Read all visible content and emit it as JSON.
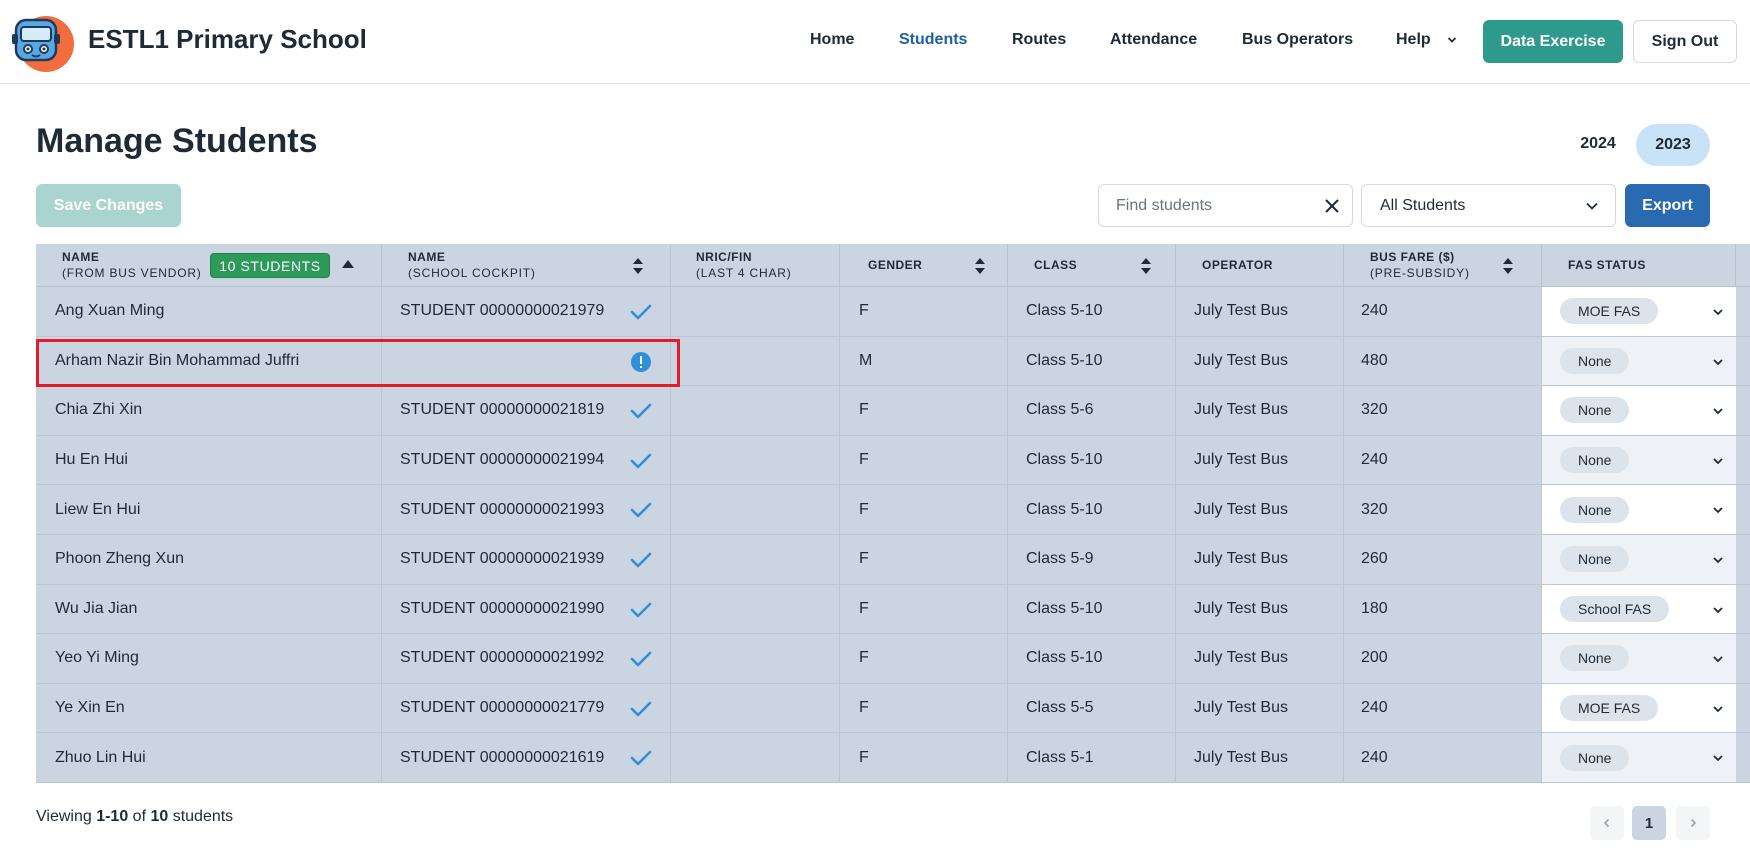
{
  "header": {
    "school_name": "ESTL1 Primary School",
    "nav": [
      {
        "label": "Home",
        "active": false
      },
      {
        "label": "Students",
        "active": true
      },
      {
        "label": "Routes",
        "active": false
      },
      {
        "label": "Attendance",
        "active": false
      },
      {
        "label": "Bus Operators",
        "active": false
      },
      {
        "label": "Help",
        "active": false,
        "has_dropdown": true
      }
    ],
    "data_exercise_label": "Data Exercise",
    "sign_out_label": "Sign Out"
  },
  "page": {
    "title": "Manage Students",
    "years": [
      "2024",
      "2023"
    ],
    "selected_year": "2023",
    "save_label": "Save Changes",
    "search": {
      "placeholder": "Find students",
      "value": ""
    },
    "filter": {
      "selected": "All Students"
    },
    "export_label": "Export"
  },
  "table": {
    "columns": {
      "name_vendor": {
        "l1": "NAME",
        "l2": "(FROM BUS VENDOR)"
      },
      "student_count": "10 STUDENTS",
      "name_cockpit": {
        "l1": "NAME",
        "l2": "(SCHOOL COCKPIT)"
      },
      "nric": {
        "l1": "NRIC/FIN",
        "l2": "(LAST 4 CHAR)"
      },
      "gender": "GENDER",
      "class": "CLASS",
      "operator": "OPERATOR",
      "fare": {
        "l1": "BUS FARE ($)",
        "l2": "(PRE-SUBSIDY)"
      },
      "fas": "FAS STATUS"
    },
    "rows": [
      {
        "vendor_name": "Ang Xuan Ming",
        "cockpit_name": "STUDENT 00000000021979",
        "matched": true,
        "nric": "",
        "gender": "F",
        "class": "Class 5-10",
        "operator": "July Test Bus",
        "fare": "240",
        "fas": "MOE FAS"
      },
      {
        "vendor_name": "Arham Nazir Bin Mohammad Juffri",
        "cockpit_name": "",
        "matched": false,
        "nric": "",
        "gender": "M",
        "class": "Class 5-10",
        "operator": "July Test Bus",
        "fare": "480",
        "fas": "None"
      },
      {
        "vendor_name": "Chia Zhi Xin",
        "cockpit_name": "STUDENT 00000000021819",
        "matched": true,
        "nric": "",
        "gender": "F",
        "class": "Class 5-6",
        "operator": "July Test Bus",
        "fare": "320",
        "fas": "None"
      },
      {
        "vendor_name": "Hu En Hui",
        "cockpit_name": "STUDENT 00000000021994",
        "matched": true,
        "nric": "",
        "gender": "F",
        "class": "Class 5-10",
        "operator": "July Test Bus",
        "fare": "240",
        "fas": "None"
      },
      {
        "vendor_name": "Liew En Hui",
        "cockpit_name": "STUDENT 00000000021993",
        "matched": true,
        "nric": "",
        "gender": "F",
        "class": "Class 5-10",
        "operator": "July Test Bus",
        "fare": "320",
        "fas": "None"
      },
      {
        "vendor_name": "Phoon Zheng Xun",
        "cockpit_name": "STUDENT 00000000021939",
        "matched": true,
        "nric": "",
        "gender": "F",
        "class": "Class 5-9",
        "operator": "July Test Bus",
        "fare": "260",
        "fas": "None"
      },
      {
        "vendor_name": "Wu Jia Jian",
        "cockpit_name": "STUDENT 00000000021990",
        "matched": true,
        "nric": "",
        "gender": "F",
        "class": "Class 5-10",
        "operator": "July Test Bus",
        "fare": "180",
        "fas": "School FAS"
      },
      {
        "vendor_name": "Yeo Yi Ming",
        "cockpit_name": "STUDENT 00000000021992",
        "matched": true,
        "nric": "",
        "gender": "F",
        "class": "Class 5-10",
        "operator": "July Test Bus",
        "fare": "200",
        "fas": "None"
      },
      {
        "vendor_name": "Ye Xin En",
        "cockpit_name": "STUDENT 00000000021779",
        "matched": true,
        "nric": "",
        "gender": "F",
        "class": "Class 5-5",
        "operator": "July Test Bus",
        "fare": "240",
        "fas": "MOE FAS"
      },
      {
        "vendor_name": "Zhuo Lin Hui",
        "cockpit_name": "STUDENT 00000000021619",
        "matched": true,
        "nric": "",
        "gender": "F",
        "class": "Class 5-1",
        "operator": "July Test Bus",
        "fare": "240",
        "fas": "None"
      }
    ]
  },
  "footer": {
    "viewing_prefix": "Viewing ",
    "range": "1-10",
    "of": " of ",
    "total": "10",
    "suffix": " students",
    "current_page": "1"
  },
  "colors": {
    "accent_teal": "#2e9a8c",
    "accent_blue": "#2a6ab0",
    "badge_green": "#2e9a5a",
    "check_blue": "#2f8fd8",
    "highlight_red": "#e11d2a"
  }
}
